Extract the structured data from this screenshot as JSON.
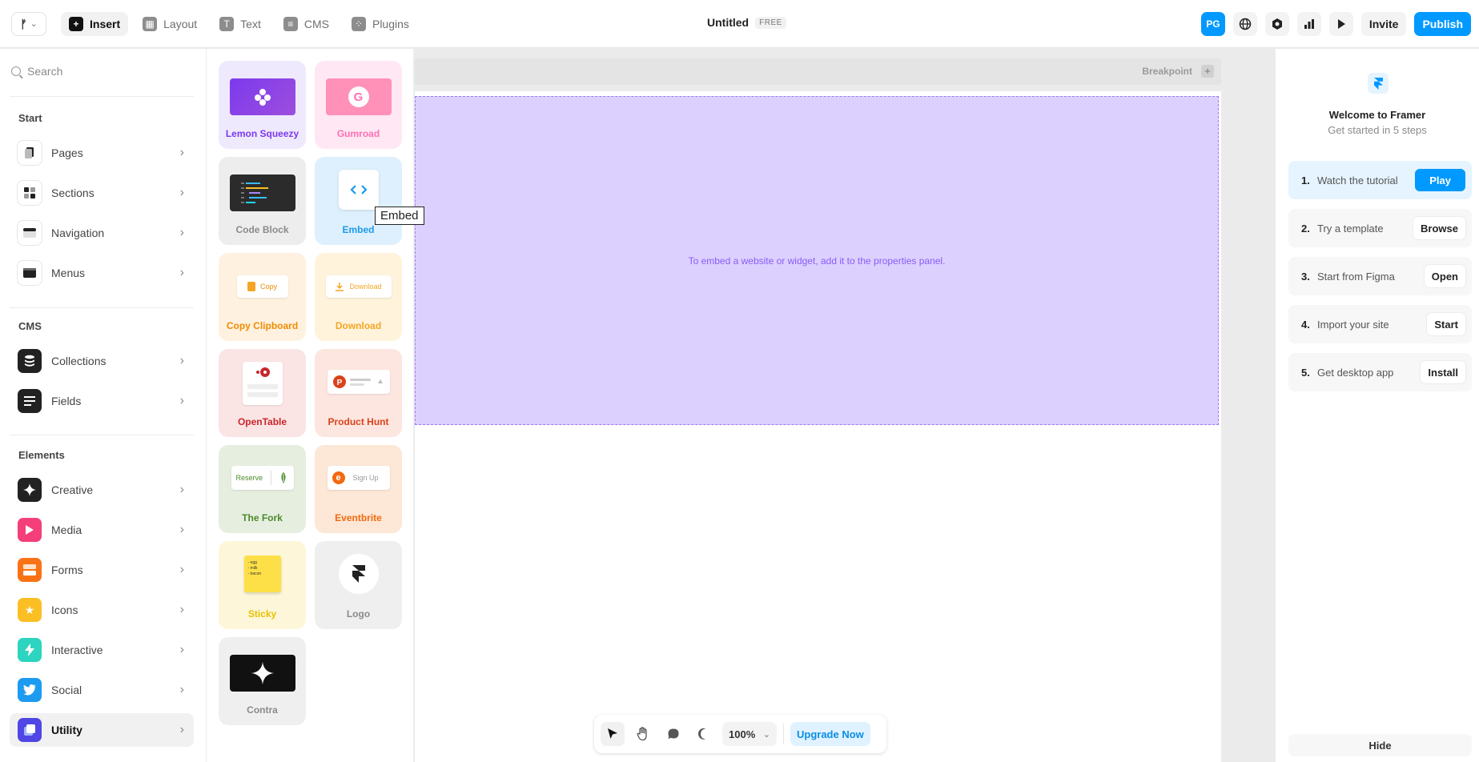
{
  "topbar": {
    "tabs": [
      {
        "label": "Insert",
        "icon": "plus-icon"
      },
      {
        "label": "Layout",
        "icon": "layout-icon"
      },
      {
        "label": "Text",
        "icon": "text-icon"
      },
      {
        "label": "CMS",
        "icon": "database-icon"
      },
      {
        "label": "Plugins",
        "icon": "plugins-icon"
      }
    ],
    "doc_title": "Untitled",
    "plan_badge": "FREE",
    "avatar_initials": "PG",
    "invite_label": "Invite",
    "publish_label": "Publish"
  },
  "sidebar": {
    "search_placeholder": "Search",
    "sections": [
      {
        "label": "Start",
        "items": [
          "Pages",
          "Sections",
          "Navigation",
          "Menus"
        ]
      },
      {
        "label": "CMS",
        "items": [
          "Collections",
          "Fields"
        ]
      },
      {
        "label": "Elements",
        "items": [
          "Creative",
          "Media",
          "Forms",
          "Icons",
          "Interactive",
          "Social",
          "Utility"
        ]
      }
    ],
    "active_item": "Utility"
  },
  "components": [
    {
      "label": "Lemon Squeezy",
      "color": "#7c3aed"
    },
    {
      "label": "Gumroad",
      "color": "#ff6fb5"
    },
    {
      "label": "Code Block",
      "color": "#8a8a8a"
    },
    {
      "label": "Embed",
      "color": "#1a9bea"
    },
    {
      "label": "Copy Clipboard",
      "color": "#f08c00",
      "visual_text": "Copy"
    },
    {
      "label": "Download",
      "color": "#f5a524",
      "visual_text": "Download"
    },
    {
      "label": "OpenTable",
      "color": "#c8252c"
    },
    {
      "label": "Product Hunt",
      "color": "#d9421b"
    },
    {
      "label": "The Fork",
      "color": "#4a8a2a",
      "visual_text": "Reserve"
    },
    {
      "label": "Eventbrite",
      "color": "#f2690f",
      "visual_text": "Sign Up"
    },
    {
      "label": "Sticky",
      "color": "#e8c100",
      "visual_text": "- egg\n- milk\n- bacon"
    },
    {
      "label": "Logo",
      "color": "#8a8a8a"
    },
    {
      "label": "Contra",
      "color": "#8a8a8a"
    }
  ],
  "tooltip": "Embed",
  "canvas": {
    "breakpoint_label": "Breakpoint",
    "embed_hint": "To embed a website or widget, add it to the properties panel."
  },
  "bottom_toolbar": {
    "zoom": "100%",
    "upgrade_label": "Upgrade Now"
  },
  "onboarding": {
    "title": "Welcome to Framer",
    "subtitle": "Get started in 5 steps",
    "steps": [
      {
        "num": "1.",
        "label": "Watch the tutorial",
        "action": "Play"
      },
      {
        "num": "2.",
        "label": "Try a template",
        "action": "Browse"
      },
      {
        "num": "3.",
        "label": "Start from Figma",
        "action": "Open"
      },
      {
        "num": "4.",
        "label": "Import your site",
        "action": "Start"
      },
      {
        "num": "5.",
        "label": "Get desktop app",
        "action": "Install"
      }
    ],
    "hide_label": "Hide"
  }
}
